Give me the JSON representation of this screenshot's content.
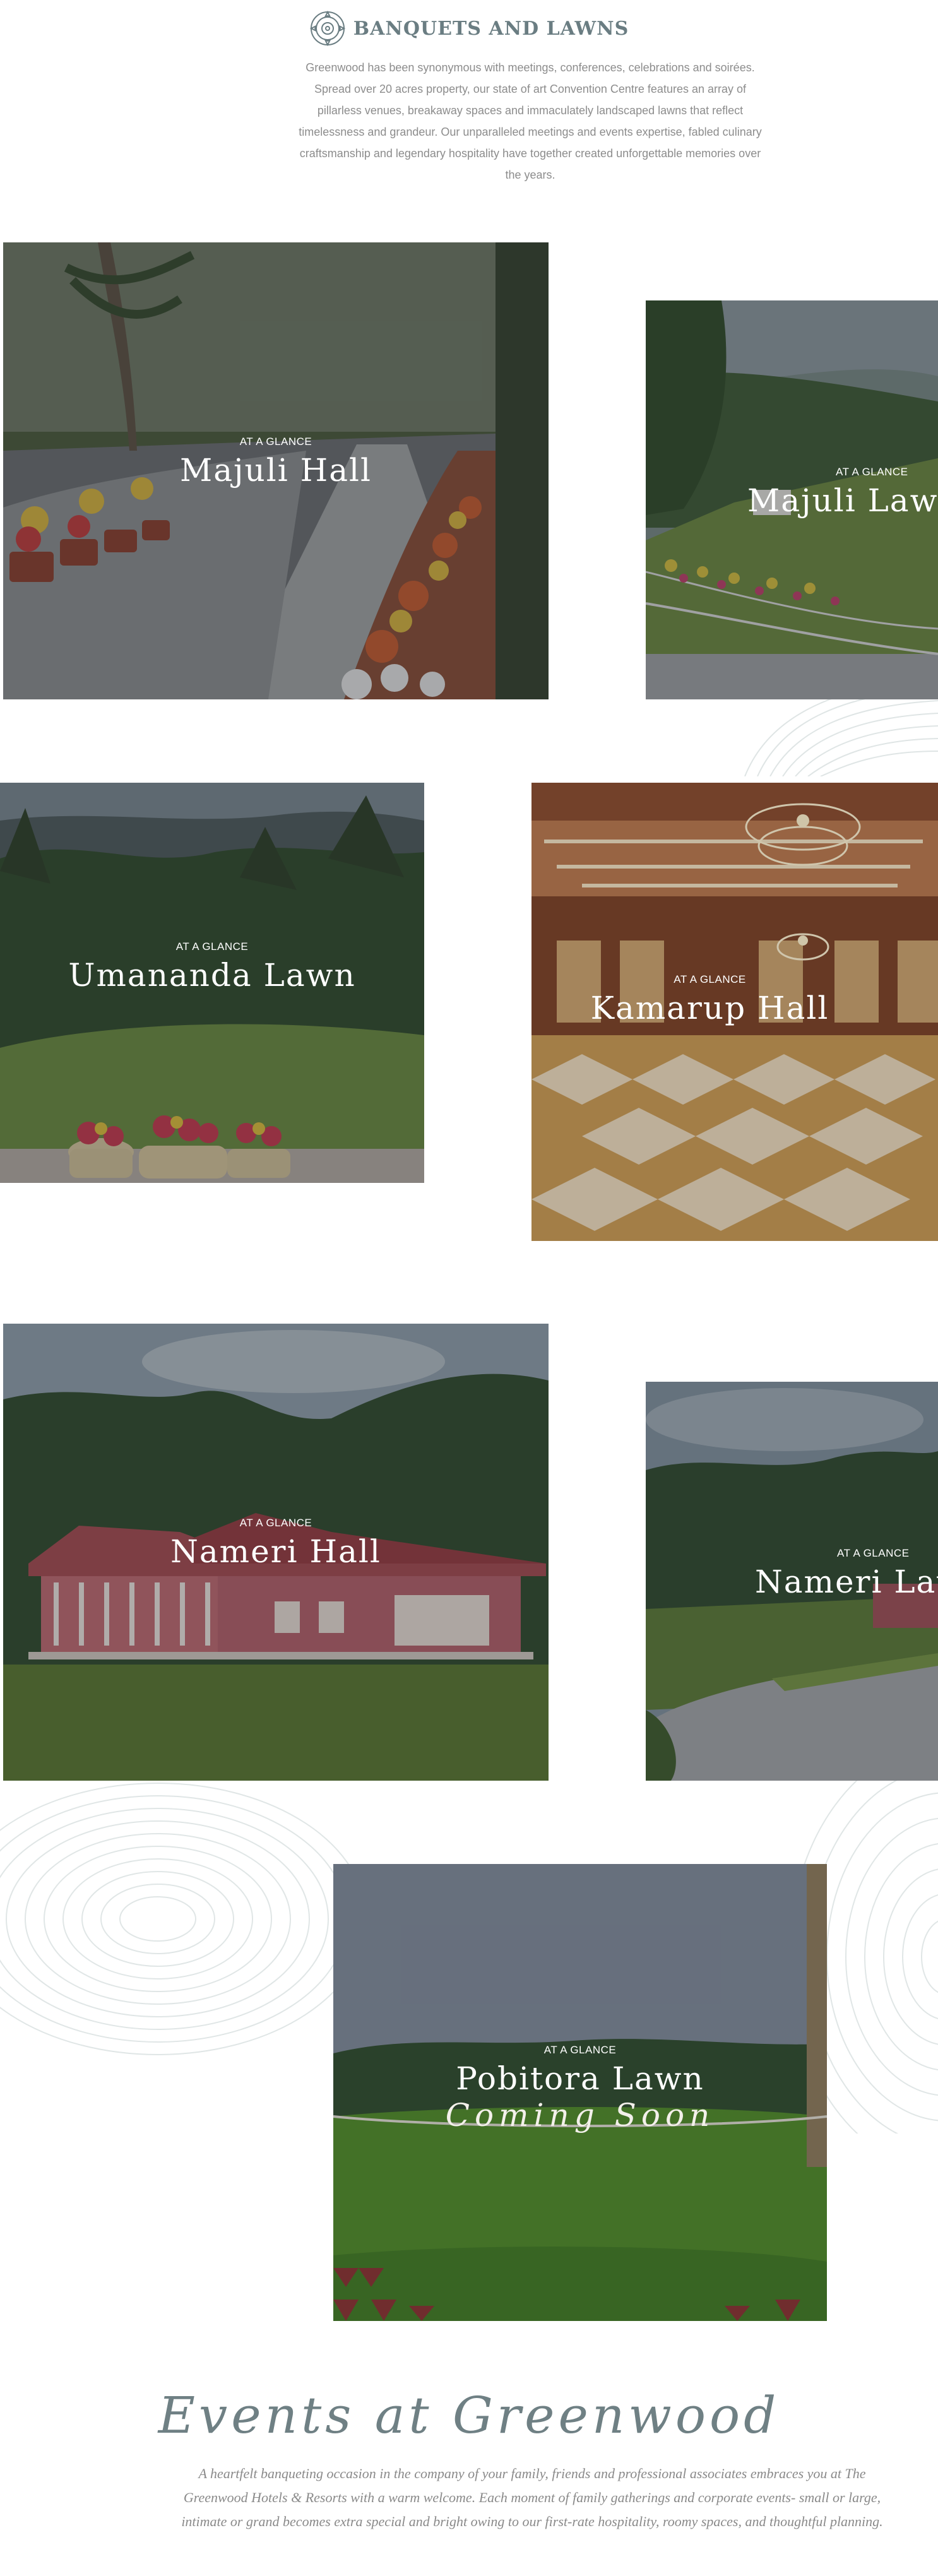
{
  "header": {
    "title": "BANQUETS AND LAWNS",
    "description": "Greenwood has been synonymous with meetings, conferences, celebrations and soirées. Spread over 20 acres property, our state of art Convention Centre features an array of pillarless venues, breakaway spaces and immaculately landscaped lawns that reflect timelessness and grandeur. Our unparalleled meetings and events expertise, fabled culinary craftsmanship and legendary hospitality have together created unforgettable memories over the years."
  },
  "venues": [
    {
      "glance": "AT A GLANCE",
      "name": "Majuli Hall"
    },
    {
      "glance": "AT A GLANCE",
      "name": "Majuli Lawn"
    },
    {
      "glance": "AT A GLANCE",
      "name": "Umananda Lawn"
    },
    {
      "glance": "AT A GLANCE",
      "name": "Kamarup Hall"
    },
    {
      "glance": "AT A GLANCE",
      "name": "Nameri Hall"
    },
    {
      "glance": "AT A GLANCE",
      "name": "Nameri Lawn"
    },
    {
      "glance": "AT A GLANCE",
      "name": "Pobitora Lawn",
      "status": "Coming Soon"
    }
  ],
  "events": {
    "title": "Events at Greenwood",
    "description": "A heartfelt banqueting occasion in the company of your family, friends and professional associates embraces you at The Greenwood Hotels & Resorts with a warm welcome. Each moment of family gatherings and corporate events- small or large, intimate or grand becomes extra special and bright owing to our first-rate hospitality, roomy spaces, and thoughtful planning."
  },
  "colors": {
    "heading": "#6a7d82",
    "body_text": "#8c8c8c",
    "grain": "#dde3e3"
  }
}
